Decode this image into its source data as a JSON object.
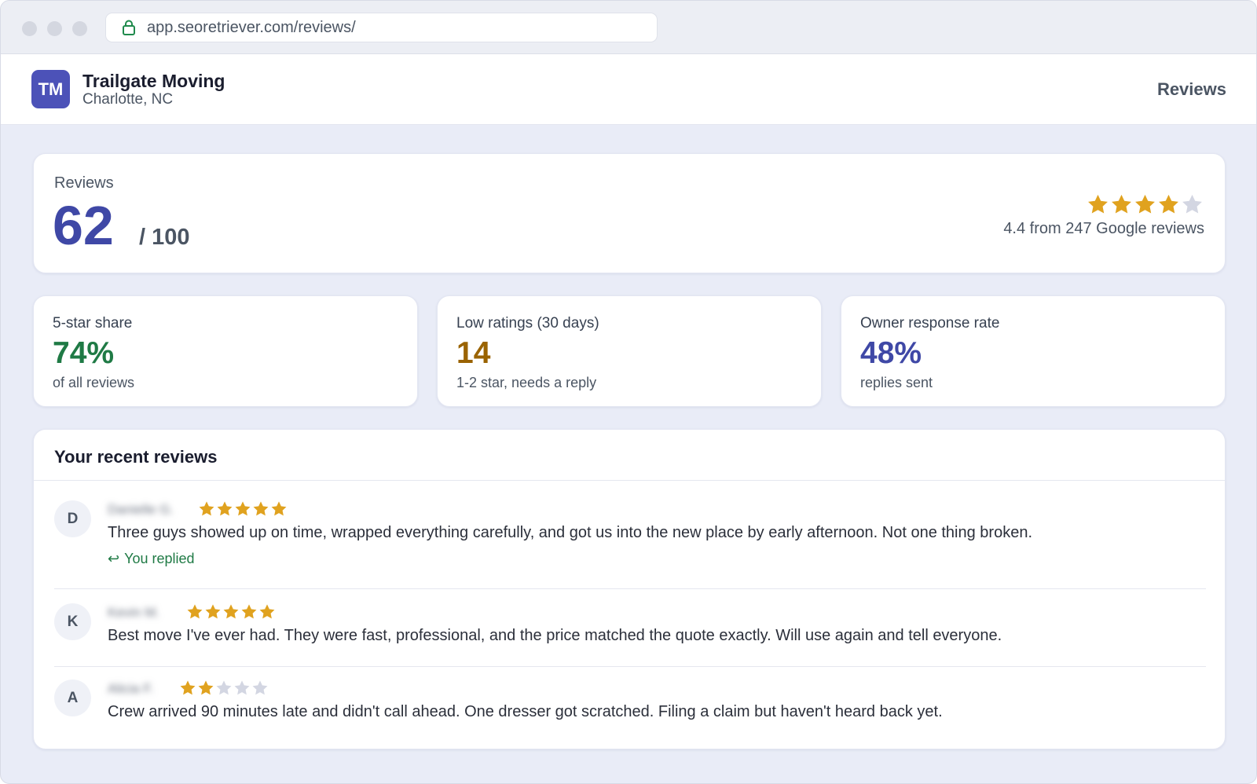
{
  "browser": {
    "url": "app.seoretriever.com/reviews/"
  },
  "header": {
    "avatar_initials": "TM",
    "business_name": "Trailgate Moving",
    "location": "Charlotte, NC",
    "nav_label": "Reviews"
  },
  "score": {
    "label": "Reviews",
    "value": "62",
    "out_of": "/ 100",
    "star_rating": 4.4,
    "rating_text": "4.4 from 247 Google reviews"
  },
  "metrics": [
    {
      "title": "5-star share",
      "value": "74%",
      "sub": "of all reviews",
      "color": "#1f7a45"
    },
    {
      "title": "Low ratings (30 days)",
      "value": "14",
      "sub": "1-2 star, needs a reply",
      "color": "#9a6300"
    },
    {
      "title": "Owner response rate",
      "value": "48%",
      "sub": "replies sent",
      "color": "#3f48a6"
    }
  ],
  "recent_reviews": {
    "title": "Your recent reviews",
    "items": [
      {
        "initial": "D",
        "reviewer": "Danielle G.",
        "stars": 5,
        "text": "Three guys showed up on time, wrapped everything carefully, and got us into the new place by early afternoon. Not one thing broken.",
        "replied_label": "You replied"
      },
      {
        "initial": "K",
        "reviewer": "Kevin M.",
        "stars": 5,
        "text": "Best move I've ever had. They were fast, professional, and the price matched the quote exactly. Will use again and tell everyone."
      },
      {
        "initial": "A",
        "reviewer": "Alicia F.",
        "stars": 2,
        "text": "Crew arrived 90 minutes late and didn't call ahead. One dresser got scratched. Filing a claim but haven't heard back yet."
      }
    ]
  },
  "colors": {
    "star_filled": "#e0a21f",
    "star_empty": "#d3d6e2",
    "accent": "#3f48a6",
    "reply_green": "#1f7a45"
  },
  "icons": {
    "lock": "lock-icon",
    "star": "star-icon",
    "reply": "reply-arrow-icon"
  }
}
